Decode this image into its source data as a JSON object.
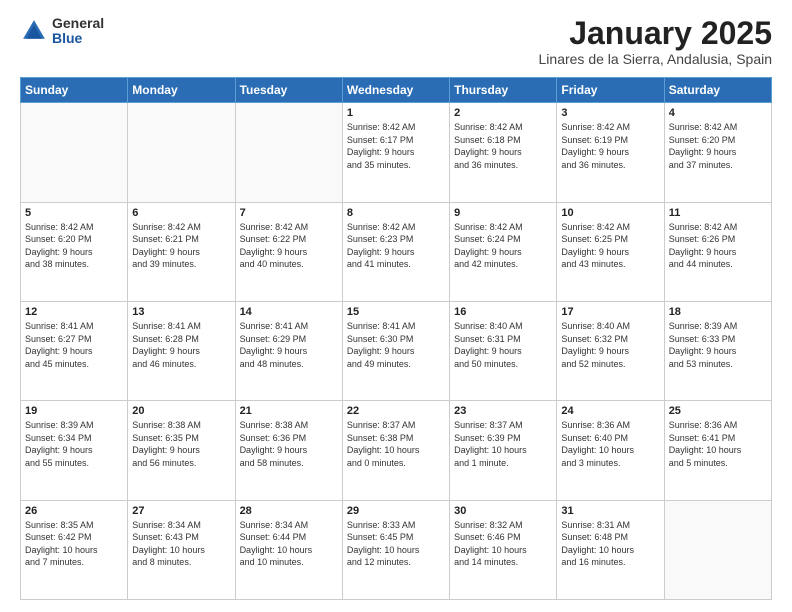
{
  "logo": {
    "general": "General",
    "blue": "Blue"
  },
  "header": {
    "title": "January 2025",
    "subtitle": "Linares de la Sierra, Andalusia, Spain"
  },
  "weekdays": [
    "Sunday",
    "Monday",
    "Tuesday",
    "Wednesday",
    "Thursday",
    "Friday",
    "Saturday"
  ],
  "weeks": [
    [
      {
        "day": "",
        "info": ""
      },
      {
        "day": "",
        "info": ""
      },
      {
        "day": "",
        "info": ""
      },
      {
        "day": "1",
        "info": "Sunrise: 8:42 AM\nSunset: 6:17 PM\nDaylight: 9 hours\nand 35 minutes."
      },
      {
        "day": "2",
        "info": "Sunrise: 8:42 AM\nSunset: 6:18 PM\nDaylight: 9 hours\nand 36 minutes."
      },
      {
        "day": "3",
        "info": "Sunrise: 8:42 AM\nSunset: 6:19 PM\nDaylight: 9 hours\nand 36 minutes."
      },
      {
        "day": "4",
        "info": "Sunrise: 8:42 AM\nSunset: 6:20 PM\nDaylight: 9 hours\nand 37 minutes."
      }
    ],
    [
      {
        "day": "5",
        "info": "Sunrise: 8:42 AM\nSunset: 6:20 PM\nDaylight: 9 hours\nand 38 minutes."
      },
      {
        "day": "6",
        "info": "Sunrise: 8:42 AM\nSunset: 6:21 PM\nDaylight: 9 hours\nand 39 minutes."
      },
      {
        "day": "7",
        "info": "Sunrise: 8:42 AM\nSunset: 6:22 PM\nDaylight: 9 hours\nand 40 minutes."
      },
      {
        "day": "8",
        "info": "Sunrise: 8:42 AM\nSunset: 6:23 PM\nDaylight: 9 hours\nand 41 minutes."
      },
      {
        "day": "9",
        "info": "Sunrise: 8:42 AM\nSunset: 6:24 PM\nDaylight: 9 hours\nand 42 minutes."
      },
      {
        "day": "10",
        "info": "Sunrise: 8:42 AM\nSunset: 6:25 PM\nDaylight: 9 hours\nand 43 minutes."
      },
      {
        "day": "11",
        "info": "Sunrise: 8:42 AM\nSunset: 6:26 PM\nDaylight: 9 hours\nand 44 minutes."
      }
    ],
    [
      {
        "day": "12",
        "info": "Sunrise: 8:41 AM\nSunset: 6:27 PM\nDaylight: 9 hours\nand 45 minutes."
      },
      {
        "day": "13",
        "info": "Sunrise: 8:41 AM\nSunset: 6:28 PM\nDaylight: 9 hours\nand 46 minutes."
      },
      {
        "day": "14",
        "info": "Sunrise: 8:41 AM\nSunset: 6:29 PM\nDaylight: 9 hours\nand 48 minutes."
      },
      {
        "day": "15",
        "info": "Sunrise: 8:41 AM\nSunset: 6:30 PM\nDaylight: 9 hours\nand 49 minutes."
      },
      {
        "day": "16",
        "info": "Sunrise: 8:40 AM\nSunset: 6:31 PM\nDaylight: 9 hours\nand 50 minutes."
      },
      {
        "day": "17",
        "info": "Sunrise: 8:40 AM\nSunset: 6:32 PM\nDaylight: 9 hours\nand 52 minutes."
      },
      {
        "day": "18",
        "info": "Sunrise: 8:39 AM\nSunset: 6:33 PM\nDaylight: 9 hours\nand 53 minutes."
      }
    ],
    [
      {
        "day": "19",
        "info": "Sunrise: 8:39 AM\nSunset: 6:34 PM\nDaylight: 9 hours\nand 55 minutes."
      },
      {
        "day": "20",
        "info": "Sunrise: 8:38 AM\nSunset: 6:35 PM\nDaylight: 9 hours\nand 56 minutes."
      },
      {
        "day": "21",
        "info": "Sunrise: 8:38 AM\nSunset: 6:36 PM\nDaylight: 9 hours\nand 58 minutes."
      },
      {
        "day": "22",
        "info": "Sunrise: 8:37 AM\nSunset: 6:38 PM\nDaylight: 10 hours\nand 0 minutes."
      },
      {
        "day": "23",
        "info": "Sunrise: 8:37 AM\nSunset: 6:39 PM\nDaylight: 10 hours\nand 1 minute."
      },
      {
        "day": "24",
        "info": "Sunrise: 8:36 AM\nSunset: 6:40 PM\nDaylight: 10 hours\nand 3 minutes."
      },
      {
        "day": "25",
        "info": "Sunrise: 8:36 AM\nSunset: 6:41 PM\nDaylight: 10 hours\nand 5 minutes."
      }
    ],
    [
      {
        "day": "26",
        "info": "Sunrise: 8:35 AM\nSunset: 6:42 PM\nDaylight: 10 hours\nand 7 minutes."
      },
      {
        "day": "27",
        "info": "Sunrise: 8:34 AM\nSunset: 6:43 PM\nDaylight: 10 hours\nand 8 minutes."
      },
      {
        "day": "28",
        "info": "Sunrise: 8:34 AM\nSunset: 6:44 PM\nDaylight: 10 hours\nand 10 minutes."
      },
      {
        "day": "29",
        "info": "Sunrise: 8:33 AM\nSunset: 6:45 PM\nDaylight: 10 hours\nand 12 minutes."
      },
      {
        "day": "30",
        "info": "Sunrise: 8:32 AM\nSunset: 6:46 PM\nDaylight: 10 hours\nand 14 minutes."
      },
      {
        "day": "31",
        "info": "Sunrise: 8:31 AM\nSunset: 6:48 PM\nDaylight: 10 hours\nand 16 minutes."
      },
      {
        "day": "",
        "info": ""
      }
    ]
  ]
}
